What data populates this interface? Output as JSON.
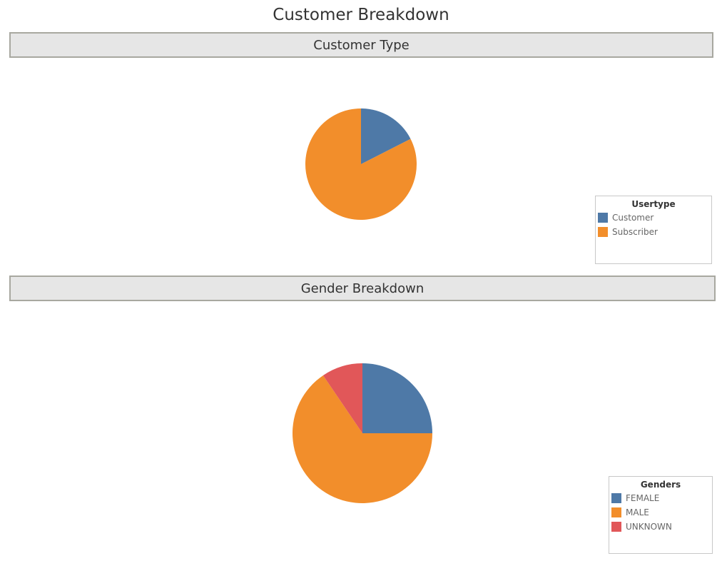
{
  "dashboard": {
    "title": "Customer Breakdown"
  },
  "sections": [
    {
      "header": "Customer Type",
      "legend_title": "Usertype"
    },
    {
      "header": "Gender Breakdown",
      "legend_title": "Genders"
    }
  ],
  "chart_data": [
    {
      "type": "pie",
      "title": "Customer Type",
      "legend_title": "Usertype",
      "legend_position": "bottom-right",
      "start": "12 o'clock, clockwise",
      "categories": [
        "Customer",
        "Subscriber"
      ],
      "values": [
        17.5,
        82.5
      ],
      "colors": [
        "#4e79a7",
        "#f28e2b"
      ]
    },
    {
      "type": "pie",
      "title": "Gender Breakdown",
      "legend_title": "Genders",
      "legend_position": "bottom-right",
      "start": "12 o'clock, clockwise",
      "categories": [
        "FEMALE",
        "MALE",
        "UNKNOWN"
      ],
      "values": [
        25.0,
        65.5,
        9.5
      ],
      "colors": [
        "#4e79a7",
        "#f28e2b",
        "#e15759"
      ]
    }
  ]
}
